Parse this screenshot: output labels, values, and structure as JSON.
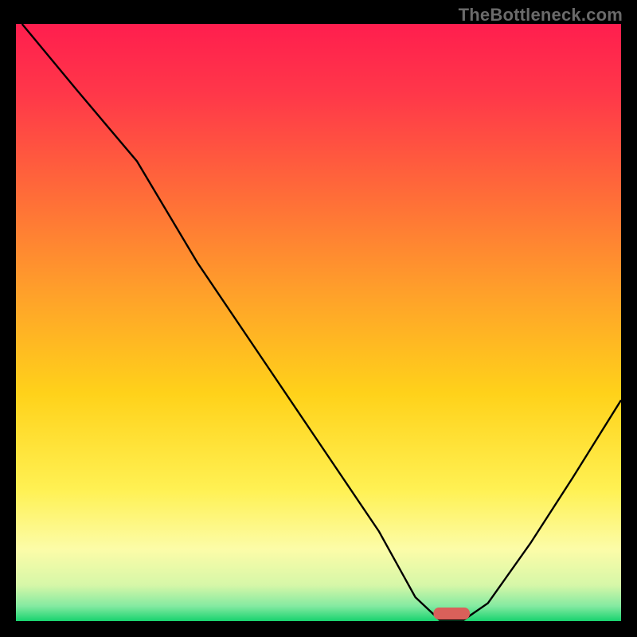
{
  "watermark": "TheBottleneck.com",
  "chart_data": {
    "type": "line",
    "title": "",
    "xlabel": "",
    "ylabel": "",
    "xlim": [
      0,
      100
    ],
    "ylim": [
      0,
      100
    ],
    "background_gradient": {
      "stops": [
        {
          "offset": 0.0,
          "color": "#ff1e4e"
        },
        {
          "offset": 0.12,
          "color": "#ff3849"
        },
        {
          "offset": 0.28,
          "color": "#ff6a39"
        },
        {
          "offset": 0.45,
          "color": "#ffa02a"
        },
        {
          "offset": 0.62,
          "color": "#ffd21a"
        },
        {
          "offset": 0.78,
          "color": "#fff153"
        },
        {
          "offset": 0.88,
          "color": "#fcfca8"
        },
        {
          "offset": 0.94,
          "color": "#d6f7a8"
        },
        {
          "offset": 0.975,
          "color": "#84eaa1"
        },
        {
          "offset": 1.0,
          "color": "#18d36f"
        }
      ]
    },
    "series": [
      {
        "name": "bottleneck-curve",
        "color": "#000000",
        "x": [
          1,
          10,
          20,
          30,
          40,
          50,
          60,
          66,
          70,
          74,
          78,
          85,
          92,
          100
        ],
        "y": [
          100,
          89,
          77,
          60,
          45,
          30,
          15,
          4,
          0.2,
          0.2,
          3,
          13,
          24,
          37
        ]
      }
    ],
    "marker": {
      "name": "optimum-marker",
      "color": "#d9605a",
      "x_center": 72,
      "width": 6,
      "height": 2.0
    }
  }
}
